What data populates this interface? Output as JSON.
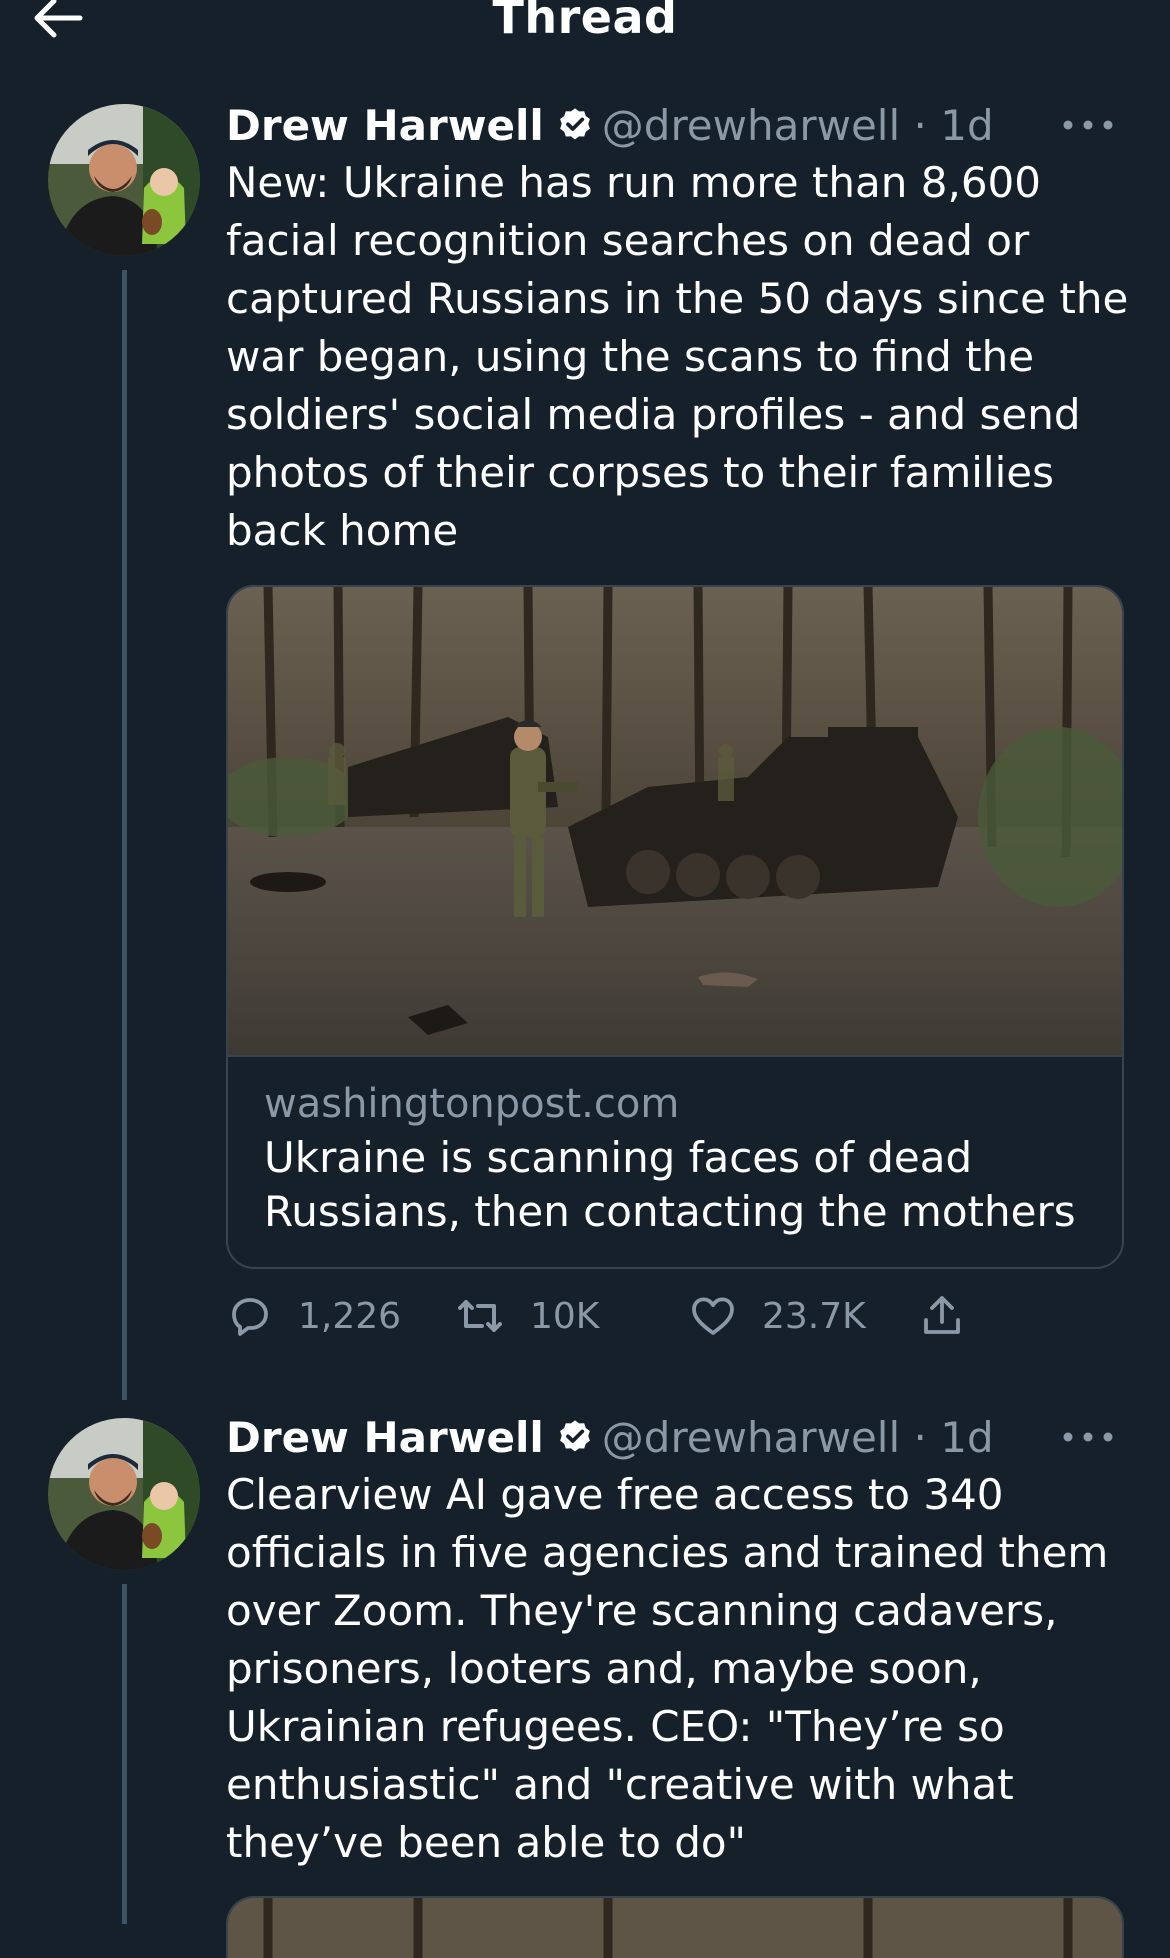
{
  "header": {
    "title": "Thread",
    "back_icon": "arrow-left-icon"
  },
  "tweets": [
    {
      "author": {
        "name": "Drew Harwell",
        "handle": "@drewharwell",
        "verified": true
      },
      "separator": "·",
      "time": "1d",
      "text": "New: Ukraine has run more than 8,600 facial recognition searches on dead or captured Russians in the 50 days since the war began, using the scans to find the soldiers' social media profiles - and send photos of their corpses to their families back home",
      "card": {
        "domain": "washingtonpost.com",
        "title": "Ukraine is scanning faces of dead Russians, then contacting the mothers"
      },
      "actions": {
        "replies": "1,226",
        "retweets": "10K",
        "likes": "23.7K"
      }
    },
    {
      "author": {
        "name": "Drew Harwell",
        "handle": "@drewharwell",
        "verified": true
      },
      "separator": "·",
      "time": "1d",
      "text": "Clearview AI gave free access to 340 officials in five agencies and trained them over Zoom. They're scanning cadavers, prisoners, looters and, maybe soon, Ukrainian refugees. CEO: \"They’re so enthusiastic\" and \"creative with what they’ve been able to do\""
    }
  ],
  "colors": {
    "background": "#15202b",
    "text": "#ffffff",
    "muted": "#8b98a5",
    "border": "#38444d",
    "thread_line": "#3d5466"
  }
}
